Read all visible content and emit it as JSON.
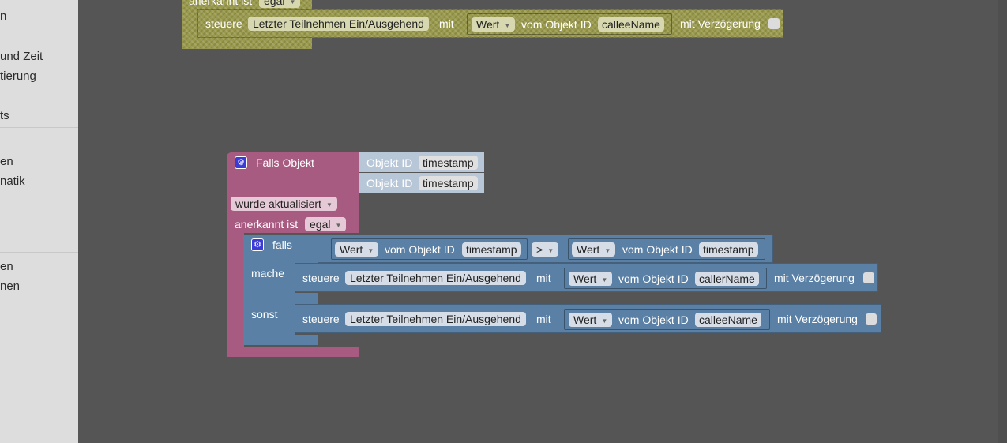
{
  "sidebar": {
    "items": [
      "n",
      "und Zeit",
      "tierung",
      "ts",
      "en",
      "natik",
      "en",
      "nen"
    ]
  },
  "top_block": {
    "header_text": "anerkannt ist",
    "header_dropdown": "egal",
    "steuere": "steuere",
    "target": "Letzter Teilnehmen Ein/Ausgehend",
    "mit": "mit",
    "wert_dropdown": "Wert",
    "vom_objekt_id": "vom Objekt ID",
    "object_name": "calleeName",
    "delay_label": "mit Verzögerung"
  },
  "event_block": {
    "title": "Falls Objekt",
    "object_id_label": "Objekt ID",
    "object_1": "timestamp",
    "object_2": "timestamp",
    "trigger_dropdown": "wurde aktualisiert",
    "ack_label": "anerkannt ist",
    "ack_dropdown": "egal"
  },
  "if_block": {
    "falls": "falls",
    "mache": "mache",
    "sonst": "sonst",
    "compare": {
      "left_dropdown": "Wert",
      "left_label": "vom Objekt ID",
      "left_object": "timestamp",
      "operator": ">",
      "right_dropdown": "Wert",
      "right_label": "vom Objekt ID",
      "right_object": "timestamp"
    },
    "then_action": {
      "steuere": "steuere",
      "target": "Letzter Teilnehmen Ein/Ausgehend",
      "mit": "mit",
      "wert_dropdown": "Wert",
      "vom_objekt_id": "vom Objekt ID",
      "object_name": "callerName",
      "delay_label": "mit Verzögerung"
    },
    "else_action": {
      "steuere": "steuere",
      "target": "Letzter Teilnehmen Ein/Ausgehend",
      "mit": "mit",
      "wert_dropdown": "Wert",
      "vom_objekt_id": "vom Objekt ID",
      "object_name": "calleeName",
      "delay_label": "mit Verzögerung"
    }
  },
  "colors": {
    "workspace": "#555555",
    "event_block": "#a85b81",
    "logic_block": "#5b80a5",
    "control_block": "#9a9a4c"
  }
}
